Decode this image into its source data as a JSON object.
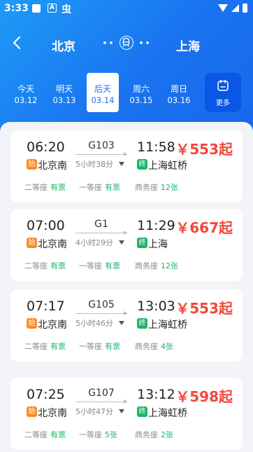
{
  "status_bar": {
    "time": "3:33",
    "a_icon_text": "A",
    "bug_icon_text": "虫"
  },
  "route": {
    "from": "北京",
    "to": "上海"
  },
  "dates": [
    {
      "label": "今天",
      "date": "03.12"
    },
    {
      "label": "明天",
      "date": "03.13"
    },
    {
      "label": "后天",
      "date": "03.14"
    },
    {
      "label": "周六",
      "date": "03.15"
    },
    {
      "label": "周日",
      "date": "03.16"
    }
  ],
  "active_date_index": 2,
  "more_label": "更多",
  "trains": [
    {
      "dep_time": "06:20",
      "train_no": "G103",
      "arr_time": "11:58",
      "duration": "5小时38分",
      "dep_station": "北京南",
      "arr_station": "上海虹桥",
      "price": "￥553起",
      "start_badge": "始",
      "end_badge": "终",
      "seats": [
        {
          "name": "二等座",
          "status": "有票"
        },
        {
          "name": "一等座",
          "status": "有票"
        },
        {
          "name": "商务座",
          "status": "12张"
        }
      ]
    },
    {
      "dep_time": "07:00",
      "train_no": "G1",
      "arr_time": "11:29",
      "duration": "4小时29分",
      "dep_station": "北京南",
      "arr_station": "上海",
      "price": "￥667起",
      "start_badge": "始",
      "end_badge": "终",
      "seats": [
        {
          "name": "二等座",
          "status": "有票"
        },
        {
          "name": "一等座",
          "status": "有票"
        },
        {
          "name": "商务座",
          "status": "12张"
        }
      ]
    },
    {
      "dep_time": "07:17",
      "train_no": "G105",
      "arr_time": "13:03",
      "duration": "5小时46分",
      "dep_station": "北京南",
      "arr_station": "上海虹桥",
      "price": "￥553起",
      "start_badge": "始",
      "end_badge": "终",
      "seats": [
        {
          "name": "二等座",
          "status": "有票"
        },
        {
          "name": "一等座",
          "status": "有票"
        },
        {
          "name": "商务座",
          "status": "4张"
        }
      ]
    },
    {
      "dep_time": "07:25",
      "train_no": "G107",
      "arr_time": "13:12",
      "duration": "5小时47分",
      "dep_station": "北京南",
      "arr_station": "上海虹桥",
      "price": "￥598起",
      "start_badge": "始",
      "end_badge": "终",
      "seats": [
        {
          "name": "二等座",
          "status": "有票"
        },
        {
          "name": "一等座",
          "status": "5张"
        },
        {
          "name": "商务座",
          "status": "2张"
        }
      ]
    }
  ],
  "colors": {
    "accent": "#1a73f0",
    "price": "#f2473b",
    "available": "#1eb46a",
    "start_badge": "#ff8a1e"
  }
}
